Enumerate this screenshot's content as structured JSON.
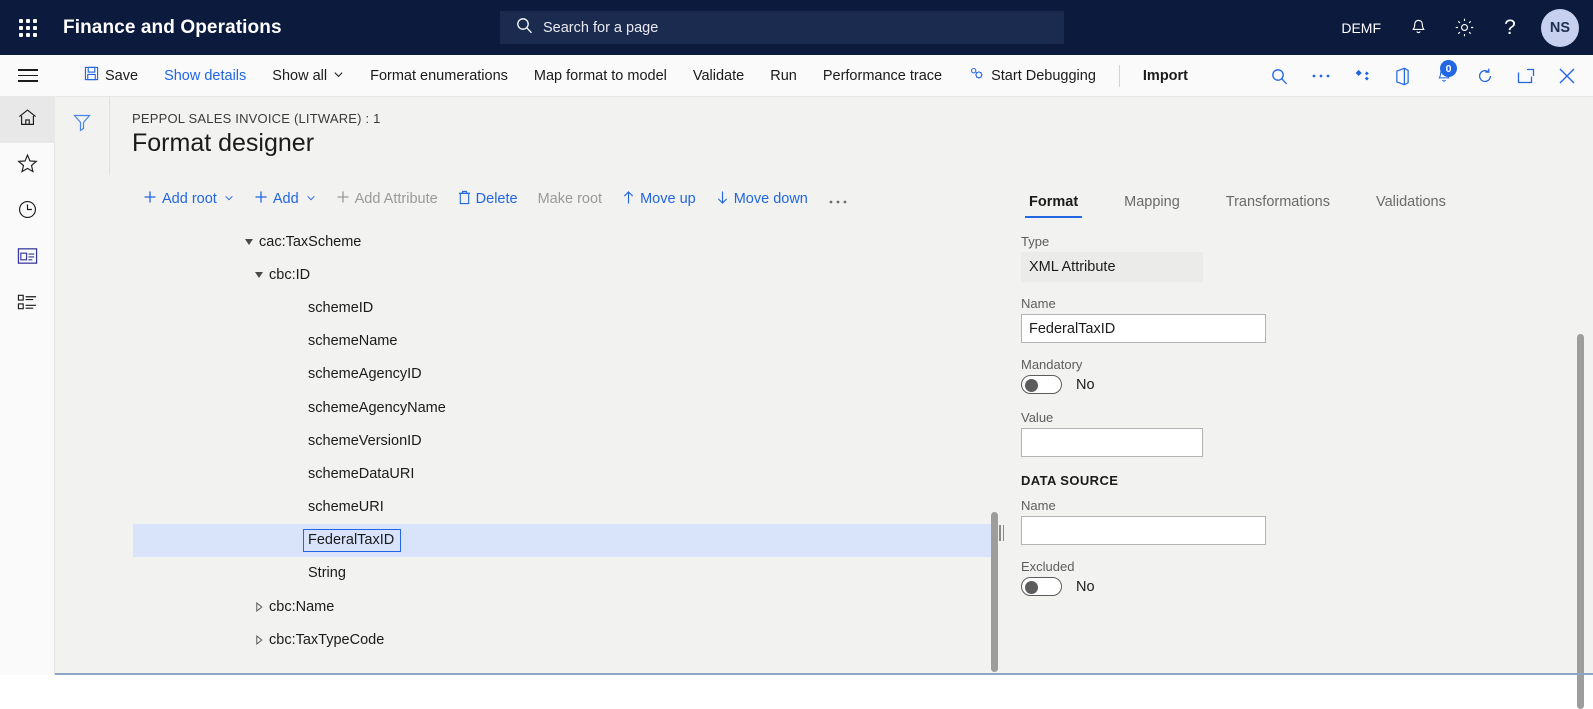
{
  "topbar": {
    "waffle_icon": "app-launcher-icon",
    "app_title": "Finance and Operations",
    "search_placeholder": "Search for a page",
    "search_icon": "search-icon",
    "company": "DEMF",
    "notifications_icon": "bell-icon",
    "settings_icon": "gear-icon",
    "help_icon": "question-mark-icon",
    "avatar_initials": "NS"
  },
  "commandbar": {
    "menu_icon": "hamburger-icon",
    "save": "Save",
    "save_icon": "save-disk-icon",
    "show_details": "Show details",
    "show_all": "Show all",
    "format_enumerations": "Format enumerations",
    "map_format_to_model": "Map format to model",
    "validate": "Validate",
    "run": "Run",
    "performance_trace": "Performance trace",
    "start_debugging": "Start Debugging",
    "start_debugging_icon": "debug-gears-icon",
    "import": "Import",
    "icons": {
      "search": "search-icon",
      "overflow": "ellipsis-icon",
      "share": "share-diamond-icon",
      "office": "office-app-icon",
      "notifications": "bell-icon",
      "notification_count": "0",
      "refresh": "refresh-icon",
      "popout": "open-in-new-window-icon",
      "close": "close-x-icon"
    }
  },
  "rail": {
    "items": [
      {
        "name": "home-icon"
      },
      {
        "name": "favorites-star-icon"
      },
      {
        "name": "recent-clock-icon"
      },
      {
        "name": "workspaces-icon"
      },
      {
        "name": "modules-list-icon"
      }
    ]
  },
  "page_header": {
    "filter_icon": "filter-funnel-icon",
    "breadcrumb": "PEPPOL SALES INVOICE (LITWARE) : 1",
    "title": "Format designer"
  },
  "tree_toolbar": {
    "buttons": [
      {
        "label": "Add root",
        "icon": "plus-icon",
        "chevron": true,
        "disabled": false
      },
      {
        "label": "Add",
        "icon": "plus-icon",
        "chevron": true,
        "disabled": false
      },
      {
        "label": "Add Attribute",
        "icon": "plus-icon",
        "chevron": false,
        "disabled": true
      },
      {
        "label": "Delete",
        "icon": "trash-icon",
        "chevron": false,
        "disabled": false
      },
      {
        "label": "Make root",
        "icon": "",
        "chevron": false,
        "disabled": true
      },
      {
        "label": "Move up",
        "icon": "arrow-up-icon",
        "chevron": false,
        "disabled": false
      },
      {
        "label": "Move down",
        "icon": "arrow-down-icon",
        "chevron": false,
        "disabled": false
      },
      {
        "label": "…",
        "icon": "",
        "chevron": false,
        "disabled": false
      }
    ]
  },
  "tree": {
    "rows": [
      {
        "label": "cac:TaxScheme",
        "indent": 1,
        "twisty": "expanded",
        "selected": false,
        "boxed": false
      },
      {
        "label": "cbc:ID",
        "indent": 2,
        "twisty": "expanded",
        "selected": false,
        "boxed": false
      },
      {
        "label": "schemeID",
        "indent": 3,
        "twisty": "none",
        "selected": false,
        "boxed": false
      },
      {
        "label": "schemeName",
        "indent": 3,
        "twisty": "none",
        "selected": false,
        "boxed": false
      },
      {
        "label": "schemeAgencyID",
        "indent": 3,
        "twisty": "none",
        "selected": false,
        "boxed": false
      },
      {
        "label": "schemeAgencyName",
        "indent": 3,
        "twisty": "none",
        "selected": false,
        "boxed": false
      },
      {
        "label": "schemeVersionID",
        "indent": 3,
        "twisty": "none",
        "selected": false,
        "boxed": false
      },
      {
        "label": "schemeDataURI",
        "indent": 3,
        "twisty": "none",
        "selected": false,
        "boxed": false
      },
      {
        "label": "schemeURI",
        "indent": 3,
        "twisty": "none",
        "selected": false,
        "boxed": false
      },
      {
        "label": "FederalTaxID",
        "indent": 3,
        "twisty": "none",
        "selected": true,
        "boxed": true
      },
      {
        "label": "String",
        "indent": 3,
        "twisty": "none",
        "selected": false,
        "boxed": false
      },
      {
        "label": "cbc:Name",
        "indent": 2,
        "twisty": "collapsed",
        "selected": false,
        "boxed": false
      },
      {
        "label": "cbc:TaxTypeCode",
        "indent": 2,
        "twisty": "collapsed",
        "selected": false,
        "boxed": false
      }
    ]
  },
  "properties": {
    "tabs": [
      {
        "label": "Format",
        "active": true
      },
      {
        "label": "Mapping",
        "active": false
      },
      {
        "label": "Transformations",
        "active": false
      },
      {
        "label": "Validations",
        "active": false
      }
    ],
    "type_label": "Type",
    "type_value": "XML Attribute",
    "name_label": "Name",
    "name_value": "FederalTaxID",
    "mandatory_label": "Mandatory",
    "mandatory_value": "No",
    "value_label": "Value",
    "value_value": "",
    "data_source_heading": "DATA SOURCE",
    "ds_name_label": "Name",
    "ds_name_value": "",
    "excluded_label": "Excluded",
    "excluded_value": "No"
  },
  "colors": {
    "nav_bg": "#0b1a3d",
    "accent": "#2266e3",
    "page_bg": "#f2f2f1",
    "selection": "#d9e4fa"
  }
}
